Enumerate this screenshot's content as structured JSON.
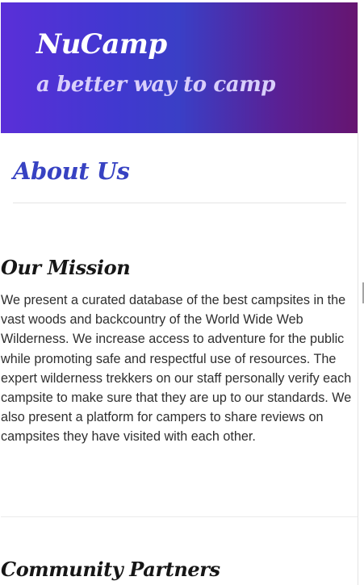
{
  "header": {
    "brand": "NuCamp",
    "tagline": "a better way to camp"
  },
  "page": {
    "title": "About Us"
  },
  "mission": {
    "heading": "Our Mission",
    "body": "We present a curated database of the best campsites in the vast woods and backcountry of the World Wide Web Wilderness. We increase access to adventure for the public while promoting safe and respectful use of resources. The expert wilderness trekkers on our staff personally verify each campsite to make sure that they are up to our standards. We also present a platform for campers to share reviews on campsites they have visited with each other."
  },
  "partners": {
    "heading": "Community Partners"
  },
  "colors": {
    "hero_start": "#5a2fd8",
    "hero_middle": "#3a3fc6",
    "hero_end": "#661570",
    "title_blue": "#3742c2",
    "tagline": "#d9cffb"
  }
}
